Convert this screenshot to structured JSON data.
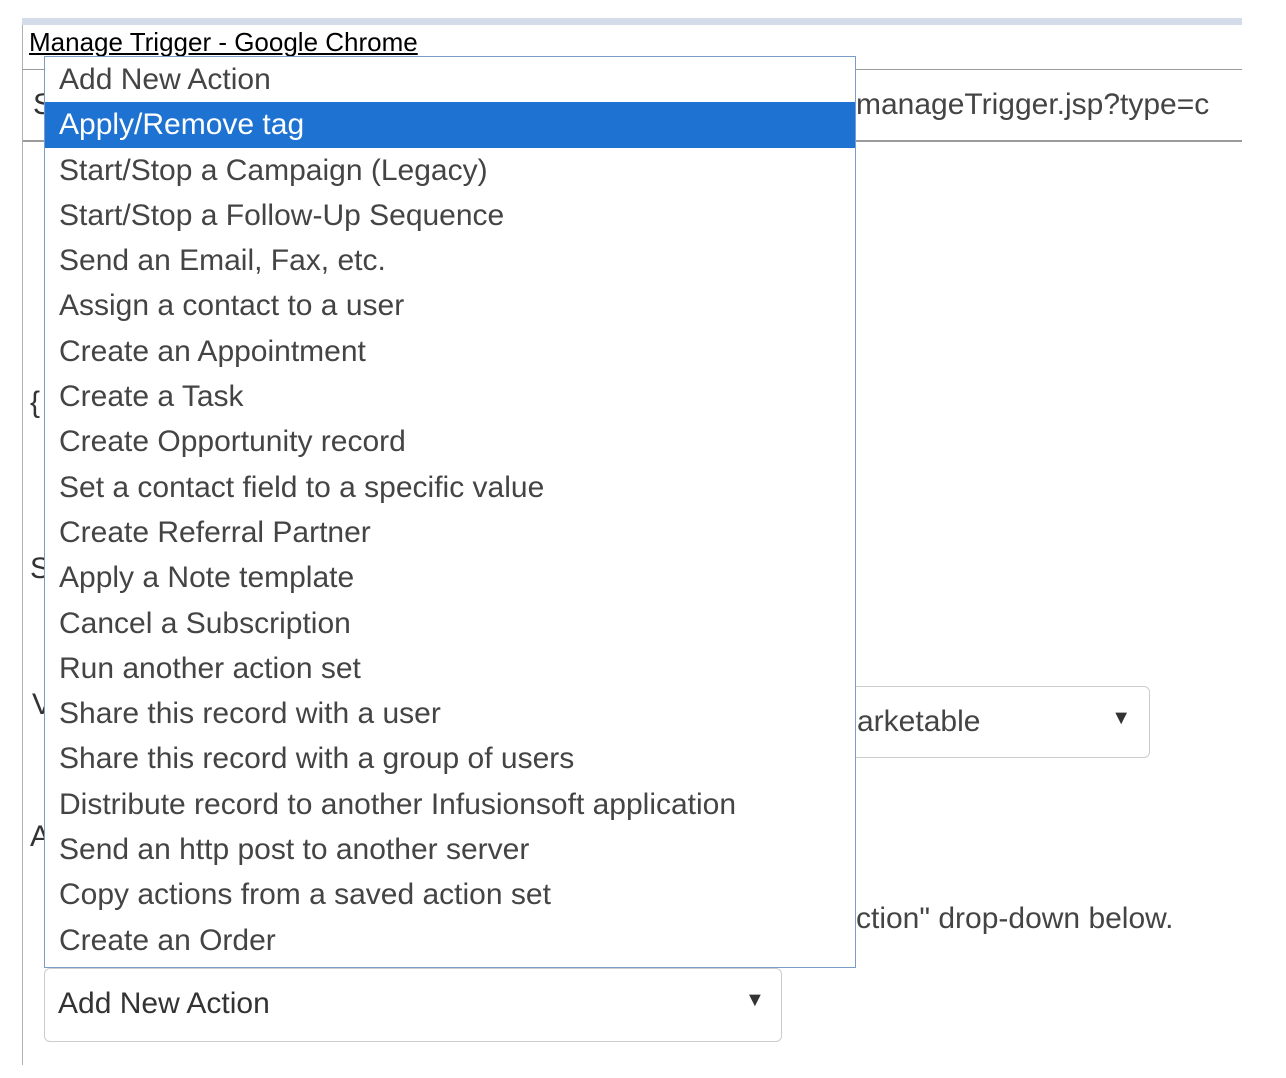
{
  "window": {
    "title": "Manage Trigger - Google Chrome",
    "address_prefix": "S",
    "address_url": "manageTrigger.jsp?type=c"
  },
  "background": {
    "fragments": [
      "{",
      "S",
      "V",
      "A"
    ],
    "status_select_value": "arketable",
    "hint_text": "ction\" drop-down below."
  },
  "dropdown": {
    "selected_index": 1,
    "items": [
      {
        "label": "Add New Action"
      },
      {
        "label": "Apply/Remove tag"
      },
      {
        "label": "Start/Stop a Campaign (Legacy)"
      },
      {
        "label": "Start/Stop a Follow-Up Sequence"
      },
      {
        "label": "Send an Email, Fax, etc."
      },
      {
        "label": "Assign a contact to a user"
      },
      {
        "label": "Create an Appointment"
      },
      {
        "label": "Create a Task"
      },
      {
        "label": "Create Opportunity record"
      },
      {
        "label": "Set a contact field to a specific value"
      },
      {
        "label": "Create Referral Partner"
      },
      {
        "label": "Apply a Note template"
      },
      {
        "label": "Cancel a Subscription"
      },
      {
        "label": "Run another action set"
      },
      {
        "label": "Share this record with a user"
      },
      {
        "label": "Share this record with a group of users"
      },
      {
        "label": "Distribute record to another Infusionsoft application"
      },
      {
        "label": "Send an http post to another server"
      },
      {
        "label": "Copy actions from a saved action set"
      },
      {
        "label": "Create an Order"
      }
    ]
  },
  "action_select": {
    "value": "Add New Action",
    "arrow_icon": "triangle-down"
  },
  "colors": {
    "highlight": "#1e73d2",
    "dropdown_border": "#7a9cc6",
    "topbar": "#d3dce8"
  }
}
